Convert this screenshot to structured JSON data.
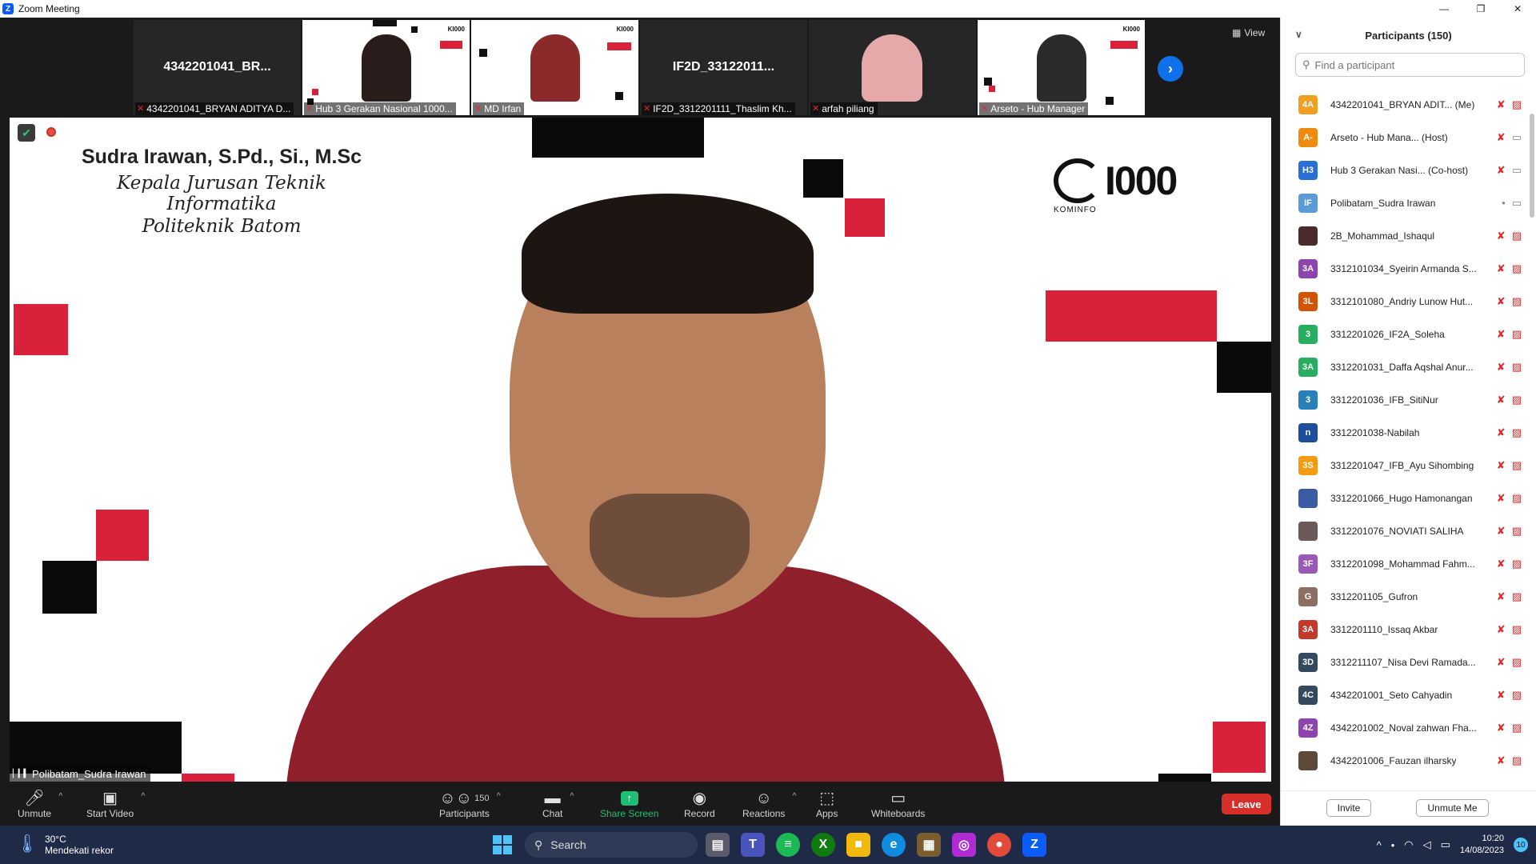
{
  "window": {
    "title": "Zoom Meeting",
    "app_icon": "Z",
    "minimize_icon": "—",
    "maximize_icon": "❐",
    "close_icon": "✕"
  },
  "gallery": {
    "tiles": [
      {
        "big_name": "4342201041_BR...",
        "label": "4342201041_BRYAN ADITYA D...",
        "muted": true,
        "video": false
      },
      {
        "big_name": "",
        "label": "Hub 3 Gerakan Nasional 1000...",
        "muted": true,
        "video": true
      },
      {
        "big_name": "",
        "label": "MD Irfan",
        "muted": true,
        "video": true
      },
      {
        "big_name": "IF2D_33122011...",
        "label": "IF2D_3312201111_Thaslim Kh...",
        "muted": true,
        "video": false
      },
      {
        "big_name": "",
        "label": "arfah piliang",
        "muted": true,
        "video": true
      },
      {
        "big_name": "",
        "label": "Arseto - Hub Manager",
        "muted": true,
        "video": true
      }
    ],
    "next_icon": "›",
    "view_label": "View"
  },
  "main_video": {
    "caption_name": "Sudra Irawan, S.Pd., Si., M.Sc",
    "caption_role": "Kepala Jurusan Teknik Informatika",
    "caption_org": "Politeknik Batom",
    "logo_text": "I000",
    "logo_sub": "KOMINFO",
    "speaker_label": "Polibatam_Sudra Irawan"
  },
  "toolbar": {
    "unmute": "Unmute",
    "start_video": "Start Video",
    "participants": "Participants",
    "participants_count": "150",
    "chat": "Chat",
    "share_screen": "Share Screen",
    "record": "Record",
    "reactions": "Reactions",
    "apps": "Apps",
    "whiteboards": "Whiteboards",
    "leave": "Leave"
  },
  "panel": {
    "title": "Participants (150)",
    "search_placeholder": "Find a participant",
    "invite": "Invite",
    "unmute_me": "Unmute Me",
    "participants": [
      {
        "initials": "4A",
        "color": "#f0a020",
        "name": "4342201041_BRYAN ADIT...  (Me)",
        "mic": "off",
        "cam": "off"
      },
      {
        "initials": "A-",
        "color": "#f08a10",
        "name": "Arseto - Hub Mana...  (Host)",
        "mic": "off",
        "cam": "on"
      },
      {
        "initials": "H3",
        "color": "#2a6fd6",
        "name": "Hub 3 Gerakan Nasi...  (Co-host)",
        "mic": "off",
        "cam": "on"
      },
      {
        "initials": "IF",
        "color": "#5a9bd8",
        "name": "Polibatam_Sudra Irawan",
        "mic": "on",
        "cam": "on"
      },
      {
        "initials": "",
        "color": "#4a2a2a",
        "name": "2B_Mohammad_Ishaqul",
        "mic": "off",
        "cam": "off"
      },
      {
        "initials": "3A",
        "color": "#8e44ad",
        "name": "3312101034_Syeirin Armanda S...",
        "mic": "off",
        "cam": "off"
      },
      {
        "initials": "3L",
        "color": "#d35400",
        "name": "3312101080_Andriy Lunow Hut...",
        "mic": "off",
        "cam": "off"
      },
      {
        "initials": "3",
        "color": "#27ae60",
        "name": "3312201026_IF2A_Soleha",
        "mic": "off",
        "cam": "off"
      },
      {
        "initials": "3A",
        "color": "#27ae60",
        "name": "3312201031_Daffa Aqshal Anur...",
        "mic": "off",
        "cam": "off"
      },
      {
        "initials": "3",
        "color": "#2980b9",
        "name": "3312201036_IFB_SitiNur",
        "mic": "off",
        "cam": "off"
      },
      {
        "initials": "n",
        "color": "#1f4e9c",
        "name": "3312201038-Nabilah",
        "mic": "off",
        "cam": "off"
      },
      {
        "initials": "3S",
        "color": "#f39c12",
        "name": "3312201047_IFB_Ayu Sihombing",
        "mic": "off",
        "cam": "off"
      },
      {
        "initials": "",
        "color": "#3b5ba5",
        "name": "3312201066_Hugo Hamonangan",
        "mic": "off",
        "cam": "off"
      },
      {
        "initials": "",
        "color": "#6b5a58",
        "name": "3312201076_NOVIATI SALIHA",
        "mic": "off",
        "cam": "off"
      },
      {
        "initials": "3F",
        "color": "#9b59b6",
        "name": "3312201098_Mohammad Fahm...",
        "mic": "off",
        "cam": "off"
      },
      {
        "initials": "G",
        "color": "#8d6e63",
        "name": "3312201105_Gufron",
        "mic": "off",
        "cam": "off"
      },
      {
        "initials": "3A",
        "color": "#c0392b",
        "name": "3312201110_Issaq Akbar",
        "mic": "off",
        "cam": "off"
      },
      {
        "initials": "3D",
        "color": "#34495e",
        "name": "3312211107_Nisa Devi Ramada...",
        "mic": "off",
        "cam": "off"
      },
      {
        "initials": "4C",
        "color": "#34495e",
        "name": "4342201001_Seto Cahyadin",
        "mic": "off",
        "cam": "off"
      },
      {
        "initials": "4Z",
        "color": "#8e44ad",
        "name": "4342201002_Noval zahwan Fha...",
        "mic": "off",
        "cam": "off"
      },
      {
        "initials": "",
        "color": "#5d4a3a",
        "name": "4342201006_Fauzan ilharsky",
        "mic": "off",
        "cam": "off"
      }
    ]
  },
  "taskbar": {
    "temp": "30°C",
    "weather_desc": "Mendekati rekor",
    "search_label": "Search",
    "time": "10:20",
    "date": "14/08/2023",
    "notif_count": "10"
  }
}
